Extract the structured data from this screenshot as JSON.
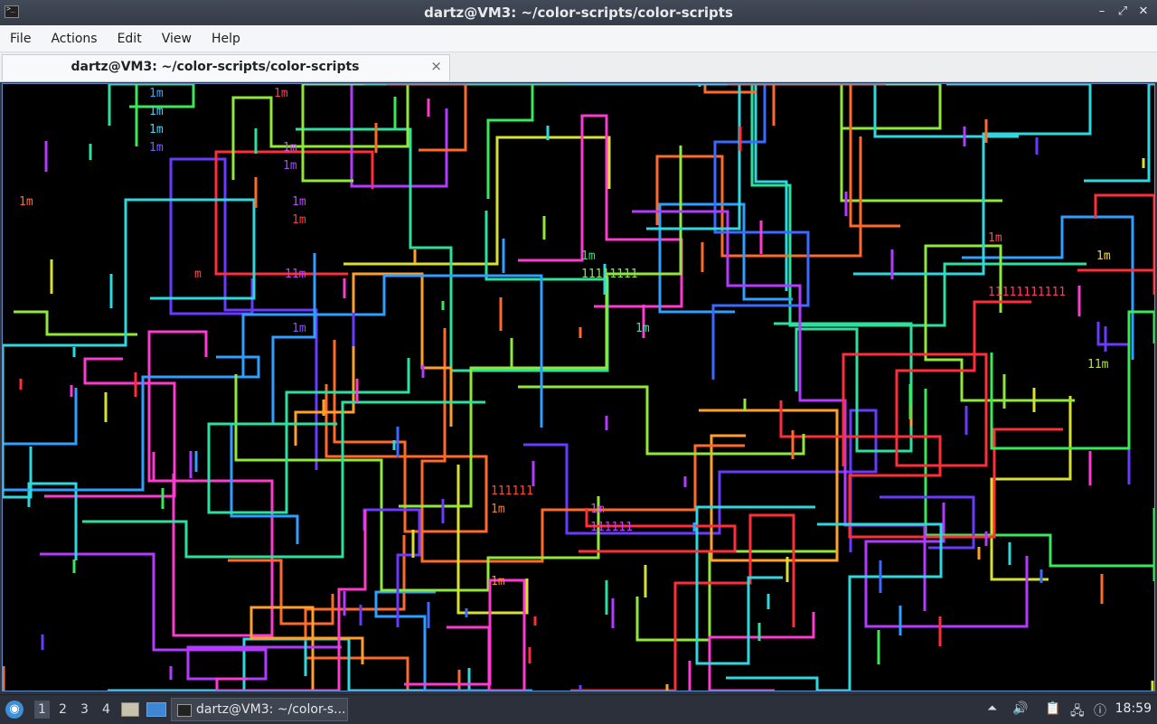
{
  "window": {
    "title": "dartz@VM3: ~/color-scripts/color-scripts"
  },
  "menu": [
    "File",
    "Actions",
    "Edit",
    "View",
    "Help"
  ],
  "tab": {
    "label": "dartz@VM3: ~/color-scripts/color-scripts",
    "close": "×"
  },
  "taskbar": {
    "workspaces": [
      "1",
      "2",
      "3",
      "4"
    ],
    "active_workspace": "1",
    "task_label": "dartz@VM3: ~/color-s...",
    "clock": "18:59"
  },
  "terminal": {
    "output": [
      {
        "text": "1m",
        "color": "#3aa6ff"
      },
      {
        "text": "1m",
        "color": "#ff3a5a"
      },
      {
        "text": "1m",
        "color": "#4ec8ff"
      },
      {
        "text": "1m",
        "color": "#ff6a3a"
      },
      {
        "text": "1m",
        "color": "#3ad8ff"
      },
      {
        "text": "1m",
        "color": "#d050ff"
      },
      {
        "text": "1m",
        "color": "#7c5cff"
      },
      {
        "text": "1m",
        "color": "#9a4cff"
      },
      {
        "text": "1m",
        "color": "#b848ff"
      },
      {
        "text": "1m",
        "color": "#ff3a3a"
      },
      {
        "text": "11m",
        "color": "#c040ff"
      },
      {
        "text": "1m",
        "color": "#8850ff"
      },
      {
        "text": "m",
        "color": "#ff4a4a"
      },
      {
        "text": "1m",
        "color": "#2fe07a"
      },
      {
        "text": "11111111",
        "color": "#8de05a"
      },
      {
        "text": "1m",
        "color": "#42e0a0"
      },
      {
        "text": "111111",
        "color": "#ff4a3a"
      },
      {
        "text": "1m",
        "color": "#ff7a2a"
      },
      {
        "text": "1m",
        "color": "#e040ff"
      },
      {
        "text": "111111",
        "color": "#c040ff"
      },
      {
        "text": "1m",
        "color": "#ff8a2a"
      },
      {
        "text": "1m",
        "color": "#ff4a4a"
      },
      {
        "text": "1m",
        "color": "#c9e040"
      },
      {
        "text": "11111111111",
        "color": "#ff3a6a"
      },
      {
        "text": "11m",
        "color": "#b8e040"
      },
      {
        "text": "1m",
        "color": "#e0c040"
      }
    ]
  },
  "colors": {
    "accent": "#5a8fd0",
    "terminal_bg": "#000000"
  }
}
